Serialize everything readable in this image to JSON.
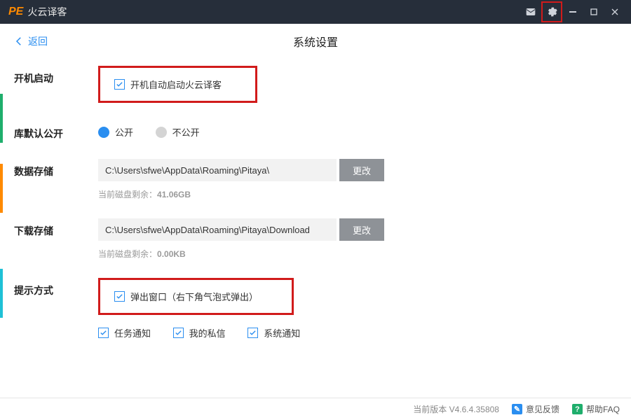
{
  "titlebar": {
    "logo": "PE",
    "app_name": "火云译客"
  },
  "header": {
    "back_label": "返回",
    "page_title": "系统设置"
  },
  "sections": {
    "startup": {
      "label": "开机启动",
      "checkbox_label": "开机自动启动火云译客",
      "checked": true
    },
    "library_public": {
      "label": "库默认公开",
      "opt_public": "公开",
      "opt_private": "不公开",
      "selected": "public"
    },
    "data_storage": {
      "label": "数据存储",
      "path": "C:\\Users\\sfwe\\AppData\\Roaming\\Pitaya\\",
      "change_btn": "更改",
      "disk_hint_prefix": "当前磁盘剩余：",
      "disk_free": "41.06GB"
    },
    "download_storage": {
      "label": "下载存储",
      "path": "C:\\Users\\sfwe\\AppData\\Roaming\\Pitaya\\Download",
      "change_btn": "更改",
      "disk_hint_prefix": "当前磁盘剩余：",
      "disk_free": "0.00KB"
    },
    "notify": {
      "label": "提示方式",
      "popup_label": "弹出窗口（右下角气泡式弹出）",
      "task_label": "任务通知",
      "pm_label": "我的私信",
      "sys_label": "系统通知"
    }
  },
  "footer": {
    "version_prefix": "当前版本",
    "version": "V4.6.4.35808",
    "feedback": "意见反馈",
    "faq": "帮助FAQ"
  }
}
